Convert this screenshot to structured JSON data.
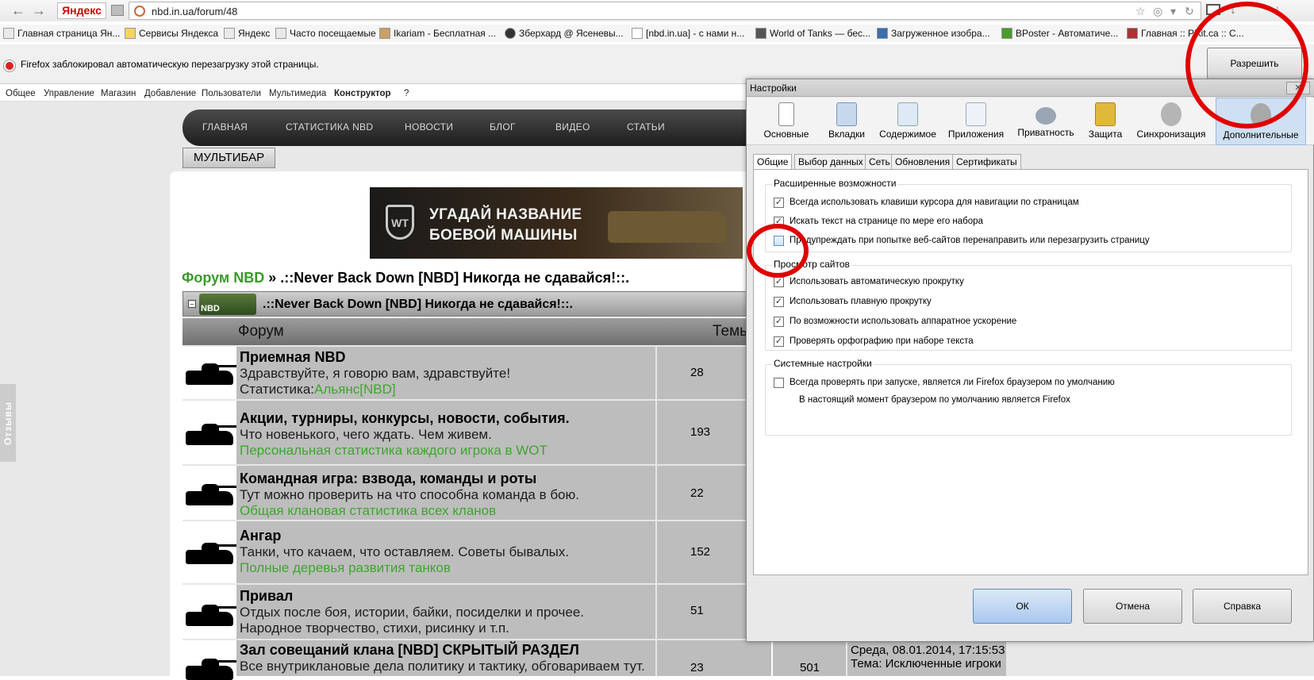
{
  "browser": {
    "back_glyph": "←",
    "fwd_glyph": "→",
    "yandex_button": "Яндекс",
    "url": "nbd.in.ua/forum/48",
    "bookmarks": [
      {
        "label": "Главная страница Ян..."
      },
      {
        "label": "Сервисы Яндекса"
      },
      {
        "label": "Яндекс"
      },
      {
        "label": "Часто посещаемые"
      },
      {
        "label": "Ikariam - Бесплатная ..."
      },
      {
        "label": "Зберхард @ Ясеневы..."
      },
      {
        "label": "[nbd.in.ua] - с нами н..."
      },
      {
        "label": "World of Tanks — бес..."
      },
      {
        "label": "Загруженное изобра..."
      },
      {
        "label": "BPoster - Автоматиче..."
      },
      {
        "label": "Главная :: Pikit.ca :: C..."
      }
    ],
    "notification": {
      "text": "Firefox заблокировал автоматическую перезагрузку этой страницы.",
      "allow_button": "Разрешить"
    }
  },
  "admin_menu": [
    "Общее",
    "Управление",
    "Магазин",
    "Добавление",
    "Пользователи",
    "Мультимедиа",
    "Конструктор",
    "?"
  ],
  "site": {
    "top_menu": [
      "ГЛАВНАЯ",
      "СТАТИСТИКА NBD",
      "НОВОСТИ",
      "БЛОГ",
      "ВИДЕО",
      "СТАТЬИ"
    ],
    "multibar": "МУЛЬТИБАР",
    "side_tab": "Отзывы",
    "banner": {
      "line1": "УГАДАЙ НАЗВАНИЕ",
      "line2": "БОЕВОЙ МАШИНЫ",
      "logo": "WT"
    },
    "breadcrumb": {
      "forum_link": "Форум NBD",
      "sep": " » ",
      "current": ".::Never Back Down [NBD] Никогда не сдавайся!::."
    },
    "section": {
      "toggle": "–",
      "logo_text": "NBD",
      "title": ".::Never Back Down [NBD] Никогда не сдавайся!::."
    },
    "columns": {
      "forum": "Форум",
      "topics": "Темы"
    },
    "forums": [
      {
        "title": "Приемная NBD",
        "desc": "Здравствуйте, я говорю вам, здравствуйте!",
        "extra_prefix": "Статистика:",
        "extra_link": "Альянс[NBD]",
        "topics": "28"
      },
      {
        "title": "Акции, турниры, конкурсы, новости, события.",
        "desc": "Что новенького, чего ждать. Чем живем.",
        "extra_link": "Персональная статистика каждого игрока в WOT",
        "topics": "193"
      },
      {
        "title": "Командная игра: взвода, команды и роты",
        "desc": "Тут можно проверить на что способна команда в бою.",
        "extra_link": "Общая клановая статистика всех кланов",
        "topics": "22"
      },
      {
        "title": "Ангар",
        "desc": "Танки, что качаем, что оставляем. Советы бывалых.",
        "extra_link": "Полные деревья развития танков",
        "topics": "152"
      },
      {
        "title": "Привал",
        "desc": "Отдых после боя, истории, байки, посиделки и прочее.",
        "desc2": "Народное творчество, стихи, рисинку и т.п.",
        "topics": "51"
      },
      {
        "title": "Зал совещаний клана [NBD] СКРЫТЫЙ РАЗДЕЛ",
        "desc": "Все внутриклановые дела политику и тактику, обговариваем тут.",
        "topics": "23",
        "posts": "501",
        "last_date": "Среда, 08.01.2014, 17:15:53",
        "last_topic": "Тема: Исключенные игроки"
      }
    ]
  },
  "dialog": {
    "title": "Настройки",
    "close": "✕",
    "toolbar": [
      {
        "label": "Основные"
      },
      {
        "label": "Вкладки"
      },
      {
        "label": "Содержимое"
      },
      {
        "label": "Приложения"
      },
      {
        "label": "Приватность"
      },
      {
        "label": "Защита"
      },
      {
        "label": "Синхронизация"
      },
      {
        "label": "Дополнительные",
        "active": true
      }
    ],
    "subtabs": [
      {
        "label": "Общие",
        "active": true
      },
      {
        "label": "Выбор данных"
      },
      {
        "label": "Сеть"
      },
      {
        "label": "Обновления"
      },
      {
        "label": "Сертификаты"
      }
    ],
    "groups": [
      {
        "label": "Расширенные возможности",
        "options": [
          {
            "text": "Всегда использовать клавиши курсора для навигации по страницам",
            "checked": true
          },
          {
            "text": "Искать текст на странице по мере его набора",
            "checked": true
          },
          {
            "text": "Предупреждать при попытке веб-сайтов перенаправить или перезагрузить страницу",
            "checked": false
          }
        ]
      },
      {
        "label": "Просмотр сайтов",
        "options": [
          {
            "text": "Использовать автоматическую прокрутку",
            "checked": true
          },
          {
            "text": "Использовать плавную прокрутку",
            "checked": true
          },
          {
            "text": "По возможности использовать аппаратное ускорение",
            "checked": true
          },
          {
            "text": "Проверять орфографию при наборе текста",
            "checked": true
          }
        ]
      },
      {
        "label": "Системные настройки",
        "options": [
          {
            "text": "Всегда проверять при запуске, является ли Firefox браузером по умолчанию",
            "checked": false
          }
        ],
        "note": "В настоящий момент браузером по умолчанию является Firefox"
      }
    ],
    "buttons": {
      "ok": "ОК",
      "cancel": "Отмена",
      "help": "Справка"
    }
  },
  "colors": {
    "accent_green": "#3fa52f",
    "annotation_red": "#e00000",
    "active_tab": "#cfe0f3"
  }
}
